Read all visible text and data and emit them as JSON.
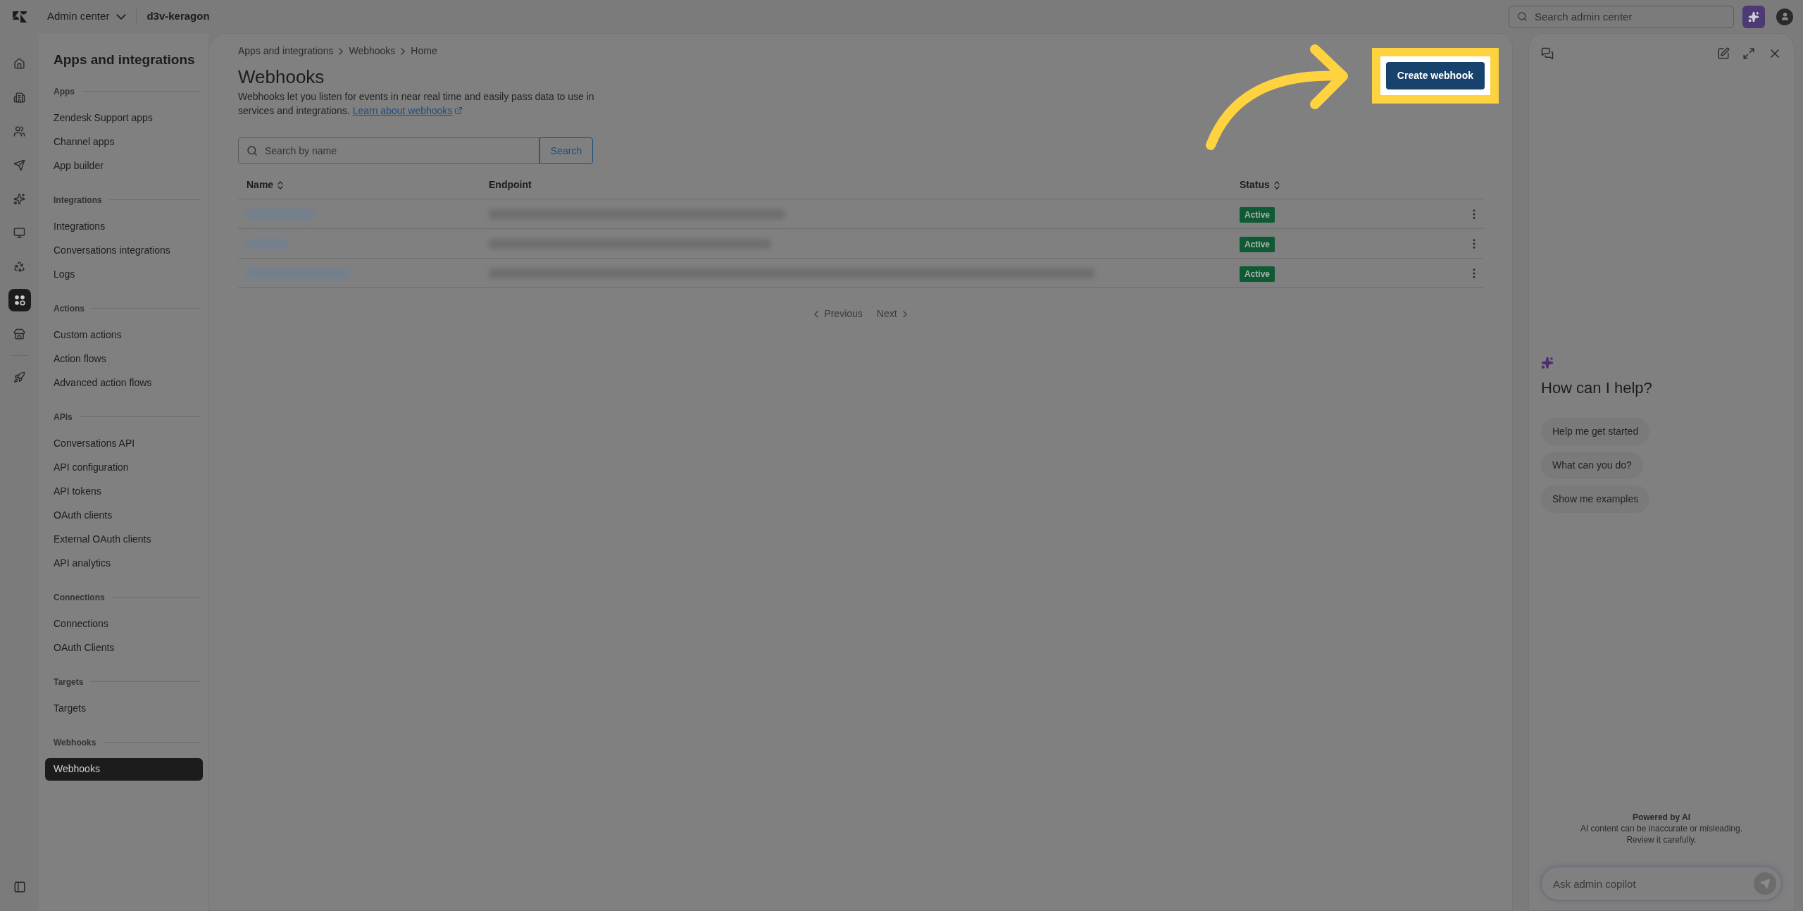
{
  "topbar": {
    "product": "Admin center",
    "account": "d3v-keragon",
    "search": {
      "placeholder": "Search admin center"
    }
  },
  "rail": [
    {
      "kind": "home",
      "selected": false
    },
    {
      "kind": "building",
      "selected": false
    },
    {
      "kind": "people",
      "selected": false
    },
    {
      "kind": "send",
      "selected": false
    },
    {
      "kind": "sparkles",
      "selected": false
    },
    {
      "kind": "monitor",
      "selected": false
    },
    {
      "kind": "recycle",
      "selected": false
    },
    {
      "kind": "apps",
      "selected": true
    },
    {
      "kind": "store",
      "selected": false
    },
    {
      "kind": "rocket",
      "selected": false
    }
  ],
  "sidebar": {
    "title": "Apps and integrations",
    "sections": [
      {
        "heading": "Apps",
        "items": [
          {
            "label": "Zendesk Support apps",
            "selected": false
          },
          {
            "label": "Channel apps",
            "selected": false
          },
          {
            "label": "App builder",
            "selected": false
          }
        ]
      },
      {
        "heading": "Integrations",
        "items": [
          {
            "label": "Integrations",
            "selected": false
          },
          {
            "label": "Conversations integrations",
            "selected": false
          },
          {
            "label": "Logs",
            "selected": false
          }
        ]
      },
      {
        "heading": "Actions",
        "items": [
          {
            "label": "Custom actions",
            "selected": false
          },
          {
            "label": "Action flows",
            "selected": false
          },
          {
            "label": "Advanced action flows",
            "selected": false
          }
        ]
      },
      {
        "heading": "APIs",
        "items": [
          {
            "label": "Conversations API",
            "selected": false
          },
          {
            "label": "API configuration",
            "selected": false
          },
          {
            "label": "API tokens",
            "selected": false
          },
          {
            "label": "OAuth clients",
            "selected": false
          },
          {
            "label": "External OAuth clients",
            "selected": false
          },
          {
            "label": "API analytics",
            "selected": false
          }
        ]
      },
      {
        "heading": "Connections",
        "items": [
          {
            "label": "Connections",
            "selected": false
          },
          {
            "label": "OAuth Clients",
            "selected": false
          }
        ]
      },
      {
        "heading": "Targets",
        "items": [
          {
            "label": "Targets",
            "selected": false
          }
        ]
      },
      {
        "heading": "Webhooks",
        "items": [
          {
            "label": "Webhooks",
            "selected": true
          }
        ]
      }
    ]
  },
  "page": {
    "breadcrumb": [
      "Apps and integrations",
      "Webhooks",
      "Home"
    ],
    "title": "Webhooks",
    "description": "Webhooks let you listen for events in near real time and easily pass data to use in services and integrations.",
    "link": "Learn about webhooks",
    "create_button": "Create webhook",
    "search": {
      "placeholder": "Search by name",
      "button": "Search"
    },
    "table": {
      "columns": [
        {
          "label": "Name",
          "sortable": true
        },
        {
          "label": "Endpoint",
          "sortable": false
        },
        {
          "label": "Status",
          "sortable": true
        }
      ],
      "rows": [
        {
          "status": "Active"
        },
        {
          "status": "Active"
        },
        {
          "status": "Active"
        }
      ]
    },
    "pagination": {
      "previous": "Previous",
      "next": "Next"
    }
  },
  "copilot": {
    "heading": "How can I help?",
    "suggestions": [
      "Help me get started",
      "What can you do?",
      "Show me examples"
    ],
    "disclaimer_title": "Powered by AI",
    "disclaimer": [
      "AI content can be inaccurate or misleading.",
      "Review it carefully."
    ],
    "input": {
      "placeholder": "Ask admin copilot"
    }
  }
}
